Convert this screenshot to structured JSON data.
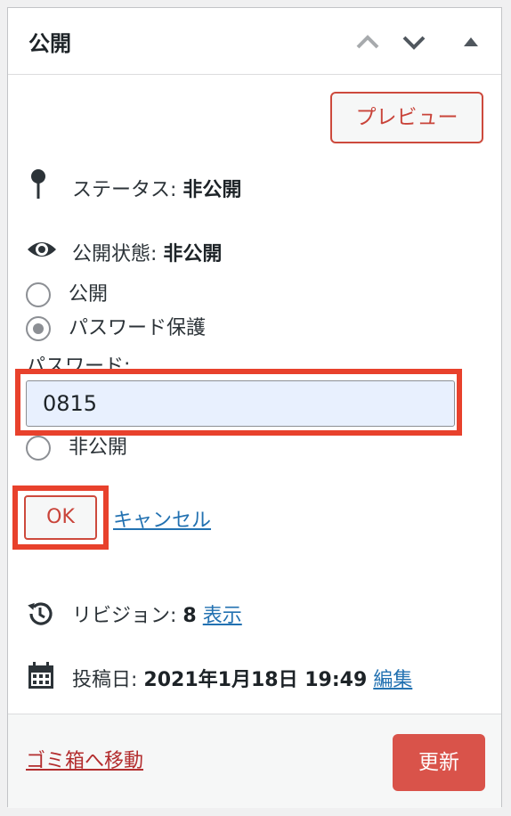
{
  "panel": {
    "title": "公開",
    "header_buttons": {
      "up": "chevron-up-icon",
      "down": "chevron-down-icon",
      "toggle": "triangle-up-icon"
    }
  },
  "preview_label": "プレビュー",
  "status": {
    "label": "ステータス:",
    "value": "非公開",
    "icon": "pin-icon"
  },
  "visibility": {
    "label": "公開状態:",
    "value": "非公開",
    "icon": "eye-icon",
    "options": [
      {
        "label": "公開",
        "checked": false
      },
      {
        "label": "パスワード保護",
        "checked": true
      },
      {
        "label": "非公開",
        "checked": false
      }
    ],
    "password_label": "パスワード:",
    "password_value": "0815",
    "ok_label": "OK",
    "cancel_label": "キャンセル"
  },
  "revisions": {
    "label": "リビジョン:",
    "count": "8",
    "link": "表示",
    "icon": "history-icon"
  },
  "published": {
    "label": "投稿日:",
    "date": "2021年1月18日 19:49",
    "link": "編集",
    "icon": "calendar-icon"
  },
  "footer": {
    "trash_label": "ゴミ箱へ移動",
    "update_label": "更新"
  },
  "colors": {
    "accent": "#cd4a3d",
    "update_bg": "#d9534a",
    "link": "#2271b1",
    "highlight": "#e8412c",
    "trash": "#b32d2e"
  }
}
